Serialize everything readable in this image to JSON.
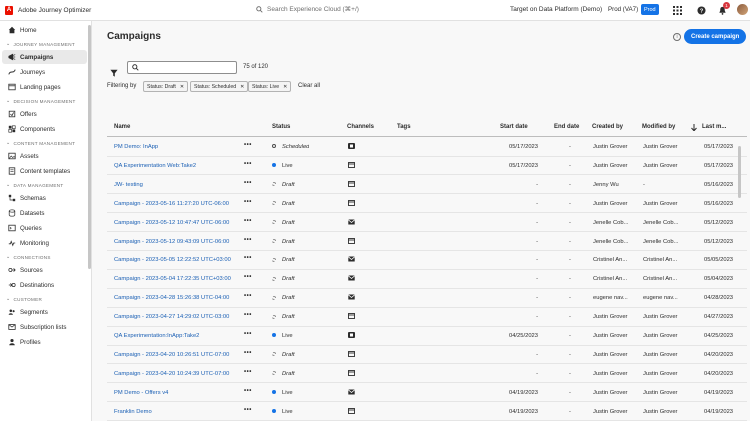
{
  "topbar": {
    "logo_letter": "A",
    "app_title": "Adobe Journey Optimizer",
    "search_placeholder": "Search Experience Cloud (⌘+/)",
    "org": "Target on Data Platform (Demo)",
    "sandbox": "Prod (VA7)",
    "env_badge": "Prod",
    "notifications": "1"
  },
  "sidebar": {
    "home": "Home",
    "sections": [
      {
        "label": "JOURNEY MANAGEMENT",
        "items": [
          {
            "label": "Campaigns",
            "icon": "campaign-icon",
            "active": true
          },
          {
            "label": "Journeys",
            "icon": "journey-icon"
          },
          {
            "label": "Landing pages",
            "icon": "landing-page-icon"
          }
        ]
      },
      {
        "label": "DECISION MANAGEMENT",
        "items": [
          {
            "label": "Offers",
            "icon": "offer-icon"
          },
          {
            "label": "Components",
            "icon": "components-icon"
          }
        ]
      },
      {
        "label": "CONTENT MANAGEMENT",
        "items": [
          {
            "label": "Assets",
            "icon": "assets-icon"
          },
          {
            "label": "Content templates",
            "icon": "template-icon"
          }
        ]
      },
      {
        "label": "DATA MANAGEMENT",
        "items": [
          {
            "label": "Schemas",
            "icon": "schema-icon"
          },
          {
            "label": "Datasets",
            "icon": "dataset-icon"
          },
          {
            "label": "Queries",
            "icon": "query-icon"
          },
          {
            "label": "Monitoring",
            "icon": "monitoring-icon"
          }
        ]
      },
      {
        "label": "CONNECTIONS",
        "items": [
          {
            "label": "Sources",
            "icon": "sources-icon"
          },
          {
            "label": "Destinations",
            "icon": "destinations-icon"
          }
        ]
      },
      {
        "label": "CUSTOMER",
        "items": [
          {
            "label": "Segments",
            "icon": "segments-icon"
          },
          {
            "label": "Subscription lists",
            "icon": "subscription-icon"
          },
          {
            "label": "Profiles",
            "icon": "profiles-icon"
          }
        ]
      }
    ]
  },
  "main": {
    "title": "Campaigns",
    "create_button": "Create campaign",
    "count": "75 of 120",
    "filtering_label": "Filtering by",
    "filters": [
      "Status: Draft",
      "Status: Scheduled",
      "Status: Live"
    ],
    "clear_all": "Clear all",
    "columns": {
      "name": "Name",
      "status": "Status",
      "channels": "Channels",
      "tags": "Tags",
      "start": "Start date",
      "end": "End date",
      "created": "Created by",
      "modified": "Modified by",
      "last": "Last m..."
    },
    "colors": {
      "scheduled": "#4b4b4b",
      "live": "#1473e6",
      "draft": "#8e8e8e"
    },
    "rows": [
      {
        "name": "PM Demo: InApp",
        "status": "Scheduled",
        "channel": "inapp",
        "start": "05/17/2023",
        "end": "-",
        "created": "Justin Grover",
        "modified": "Justin Grover",
        "last": "05/17/2023"
      },
      {
        "name": "QA Experimentation Web:Take2",
        "status": "Live",
        "channel": "web",
        "start": "05/17/2023",
        "end": "-",
        "created": "Justin Grover",
        "modified": "Justin Grover",
        "last": "05/17/2023"
      },
      {
        "name": "JW- testing",
        "status": "Draft",
        "channel": "web",
        "start": "-",
        "end": "-",
        "created": "Jenny Wu",
        "modified": "-",
        "last": "05/16/2023"
      },
      {
        "name": "Campaign - 2023-05-16 11:27:20 UTC-06:00",
        "status": "Draft",
        "channel": "web",
        "start": "-",
        "end": "-",
        "created": "Justin Grover",
        "modified": "Justin Grover",
        "last": "05/16/2023"
      },
      {
        "name": "Campaign - 2023-05-12 10:47:47 UTC-06:00",
        "status": "Draft",
        "channel": "email",
        "start": "-",
        "end": "-",
        "created": "Jenelle Cob...",
        "modified": "Jenelle Cob...",
        "last": "05/12/2023"
      },
      {
        "name": "Campaign - 2023-05-12 09:43:09 UTC-06:00",
        "status": "Draft",
        "channel": "web",
        "start": "-",
        "end": "-",
        "created": "Jenelle Cob...",
        "modified": "Jenelle Cob...",
        "last": "05/12/2023"
      },
      {
        "name": "Campaign - 2023-05-05 12:22:52 UTC+03:00",
        "status": "Draft",
        "channel": "email",
        "start": "-",
        "end": "-",
        "created": "Cristinel An...",
        "modified": "Cristinel An...",
        "last": "05/05/2023"
      },
      {
        "name": "Campaign - 2023-05-04 17:22:35 UTC+03:00",
        "status": "Draft",
        "channel": "email",
        "start": "-",
        "end": "-",
        "created": "Cristinel An...",
        "modified": "Cristinel An...",
        "last": "05/04/2023"
      },
      {
        "name": "Campaign - 2023-04-28 15:26:38 UTC-04:00",
        "status": "Draft",
        "channel": "email",
        "start": "-",
        "end": "-",
        "created": "eugene nav...",
        "modified": "eugene nav...",
        "last": "04/28/2023"
      },
      {
        "name": "Campaign - 2023-04-27 14:29:02 UTC-03:00",
        "status": "Draft",
        "channel": "web",
        "start": "-",
        "end": "-",
        "created": "Justin Grover",
        "modified": "Justin Grover",
        "last": "04/27/2023"
      },
      {
        "name": "QA Experimentation:InApp:Take2",
        "status": "Live",
        "channel": "inapp",
        "start": "04/25/2023",
        "end": "-",
        "created": "Justin Grover",
        "modified": "Justin Grover",
        "last": "04/25/2023"
      },
      {
        "name": "Campaign - 2023-04-20 10:26:51 UTC-07:00",
        "status": "Draft",
        "channel": "web",
        "start": "-",
        "end": "-",
        "created": "Justin Grover",
        "modified": "Justin Grover",
        "last": "04/20/2023"
      },
      {
        "name": "Campaign - 2023-04-20 10:24:39 UTC-07:00",
        "status": "Draft",
        "channel": "web",
        "start": "-",
        "end": "-",
        "created": "Justin Grover",
        "modified": "Justin Grover",
        "last": "04/20/2023"
      },
      {
        "name": "PM Demo - Offers v4",
        "status": "Live",
        "channel": "email",
        "start": "04/19/2023",
        "end": "-",
        "created": "Justin Grover",
        "modified": "Justin Grover",
        "last": "04/19/2023"
      },
      {
        "name": "Franklin Demo",
        "status": "Live",
        "channel": "web",
        "start": "04/19/2023",
        "end": "-",
        "created": "Justin Grover",
        "modified": "Justin Grover",
        "last": "04/19/2023"
      }
    ]
  }
}
